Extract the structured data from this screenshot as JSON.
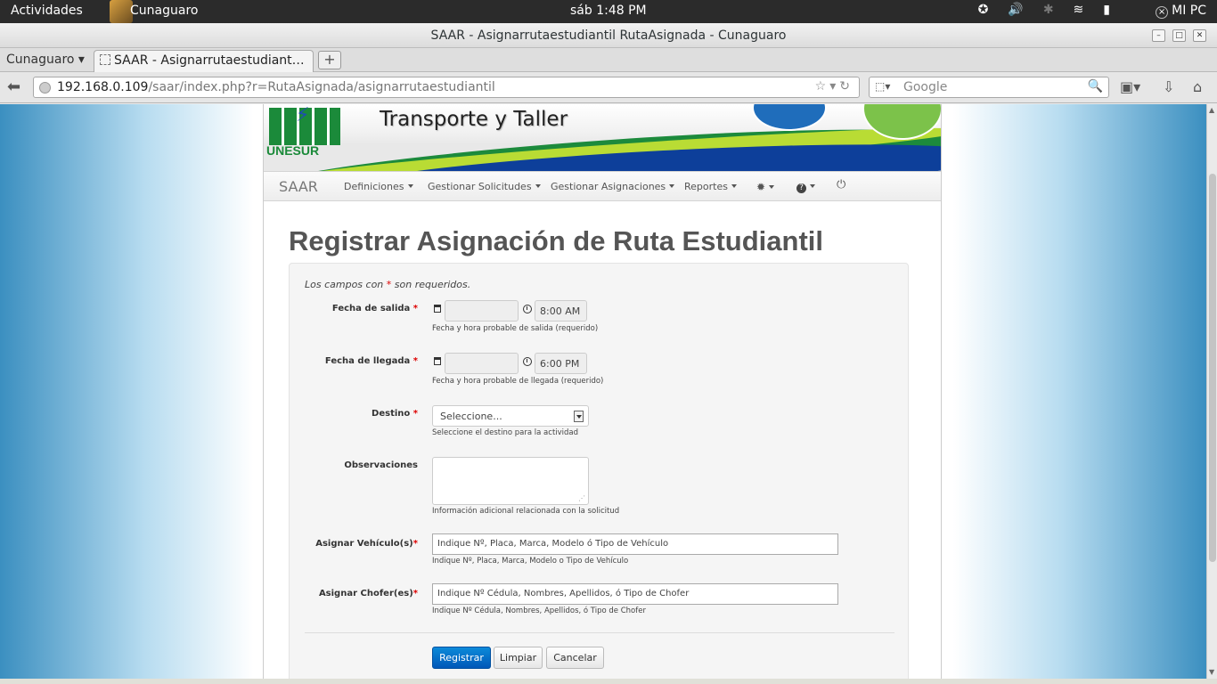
{
  "topbar": {
    "activities": "Actividades",
    "app_name": "Cunaguaro",
    "clock": "sáb  1:48 PM",
    "user": "MI PC"
  },
  "window": {
    "title": "SAAR - Asignarrutaestudiantil RutaAsignada - Cunaguaro"
  },
  "tabs": {
    "app_menu": "Cunaguaro ▾",
    "active_tab": "SAAR - Asignarrutaestudiant…",
    "new_tab": "+"
  },
  "toolbar": {
    "url_host": "192.168.0.109",
    "url_path": "/saar/index.php?r=RutaAsignada/asignarrutaestudiantil",
    "search_placeholder": "Google"
  },
  "site": {
    "brand_title": "Transporte y Taller",
    "logo_text": "UNESUR",
    "nav_brand": "SAAR",
    "nav_items": [
      "Definiciones",
      "Gestionar Solicitudes",
      "Gestionar Asignaciones",
      "Reportes"
    ]
  },
  "form": {
    "heading": "Registrar Asignación de Ruta Estudiantil",
    "note_prefix": "Los campos con ",
    "note_star": "*",
    "note_suffix": " son requeridos.",
    "fecha_salida": {
      "label": "Fecha de salida",
      "time": "8:00 AM",
      "help": "Fecha y hora probable de salida (requerido)"
    },
    "fecha_llegada": {
      "label": "Fecha de llegada",
      "time": "6:00 PM",
      "help": "Fecha y hora probable de llegada (requerido)"
    },
    "destino": {
      "label": "Destino",
      "selected": "Seleccione...",
      "help": "Seleccione el destino para la actividad"
    },
    "observaciones": {
      "label": "Observaciones",
      "help": "Información adicional relacionada con la solicitud"
    },
    "vehiculos": {
      "label": "Asignar Vehículo(s)",
      "placeholder": "Indique Nº, Placa, Marca, Modelo ó Tipo de Vehículo",
      "help": "Indique Nº, Placa, Marca, Modelo o Tipo de Vehículo"
    },
    "choferes": {
      "label": "Asignar Chofer(es)",
      "placeholder": "Indique Nº Cédula, Nombres, Apellidos, ó Tipo de Chofer",
      "help": "Indique Nº Cédula, Nombres, Apellidos, ó Tipo de Chofer"
    },
    "buttons": {
      "register": "Registrar",
      "clear": "Limpiar",
      "cancel": "Cancelar"
    }
  }
}
